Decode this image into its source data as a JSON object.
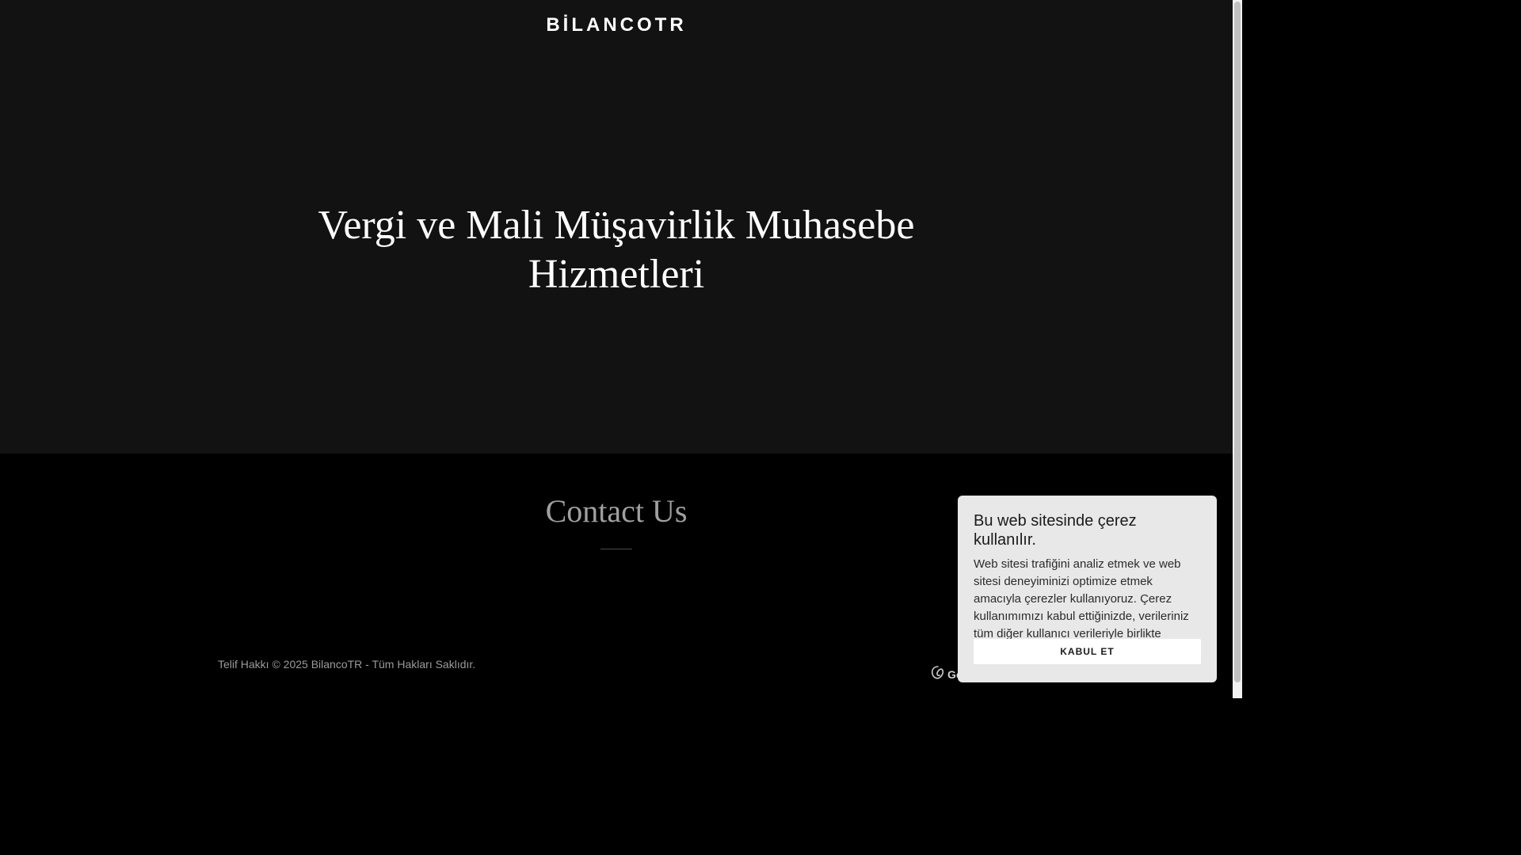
{
  "header": {
    "brand": "BİLANCOTR"
  },
  "hero": {
    "title": "Vergi ve Mali Müşavirlik Muhasebe Hizmetleri"
  },
  "contact": {
    "title": "Contact Us"
  },
  "footer": {
    "copyright": "Telif Hakkı © 2025 BilancoTR - Tüm Hakları Saklıdır.",
    "provider_partial": "Go"
  },
  "cookie_banner": {
    "title": "Bu web sitesinde çerez kullanılır.",
    "body": "Web sitesi trafiğini analiz etmek ve web sitesi deneyiminizi optimize etmek amacıyla çerezler kullanıyoruz. Çerez kullanımımızı kabul ettiğinizde, verileriniz tüm diğer kullanıcı verileriyle birlikte derlenir.",
    "accept_label": "KABUL ET"
  },
  "colors": {
    "hero_bg": "#121212",
    "page_bg": "#000000",
    "cookie_bg": "#e8e8e8",
    "text_primary": "#ffffff",
    "text_muted": "#9a9a9a"
  },
  "icons": {
    "provider_logo": "godaddy-logo-icon"
  }
}
